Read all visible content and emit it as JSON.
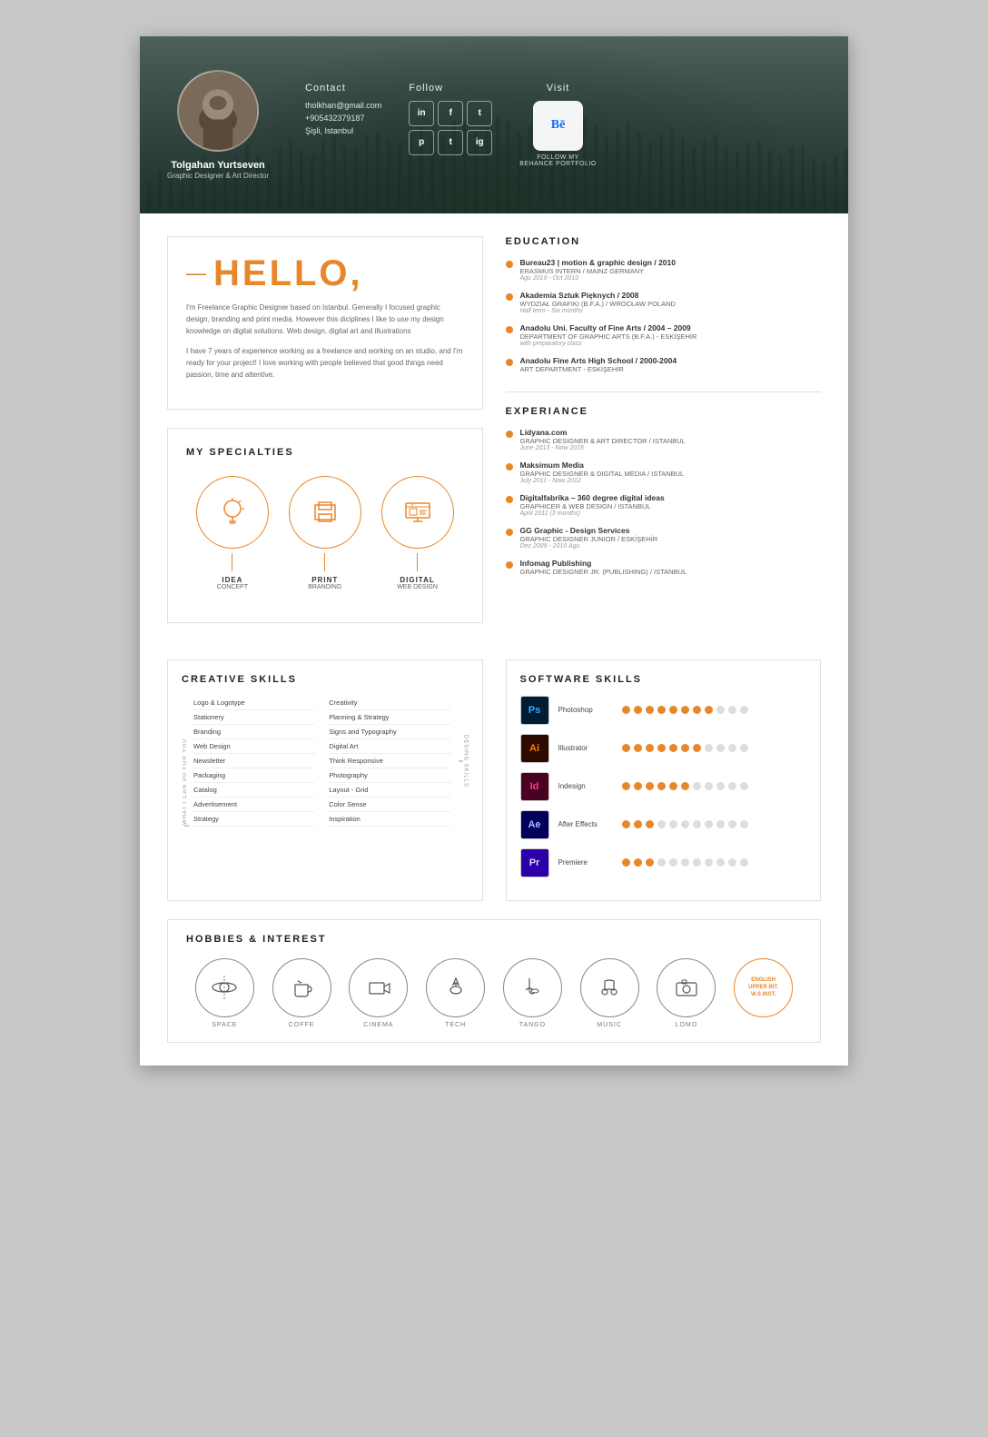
{
  "header": {
    "name": "Tolgahan Yurtseven",
    "title": "Graphic Designer & Art Director",
    "contact": {
      "label": "Contact",
      "email": "tholkhan@gmail.com",
      "phone": "+905432379187",
      "location": "Şişli, Istanbul"
    },
    "follow": {
      "label": "Follow",
      "icons": [
        "in",
        "f",
        "t",
        "p",
        "tu",
        "ig"
      ]
    },
    "visit": {
      "label": "Visit",
      "behance_text": "Bē",
      "behance_label": "FOLLOW MY\nBEHANCE PORTFOLIO"
    }
  },
  "hello": {
    "title": "HELLO,",
    "dash": "—",
    "para1": "I'm Freelance Graphic Designer based on Istanbul. Generally I focused graphic design, branding and print media. However this diciplines I like to use my design knowledge on digital solutions. Web design, digital art and illustrations",
    "para2": "I have 7 years of experience working as a freelance and working on an studio, and I'm ready for your project! I love working with people believed that good things need passion, time and attentive."
  },
  "specialties": {
    "title": "MY SPECIALTIES",
    "items": [
      {
        "icon": "💡",
        "label": "IDEA",
        "sub": "CONCEPT"
      },
      {
        "icon": "🖨",
        "label": "PRINT",
        "sub": "BRANDING"
      },
      {
        "icon": "🖥",
        "label": "DIGITAL",
        "sub": "WEB DESIGN"
      }
    ]
  },
  "education": {
    "title": "EDUCATION",
    "items": [
      {
        "title": "Bureau23 | motion & graphic design / 2010",
        "sub": "ERASMUS INTERN / MAINZ GERMANY",
        "date": "Agu 2010 - Oct 2010"
      },
      {
        "title": "Akademia Sztuk Pięknych / 2008",
        "sub": "WYDZIAŁ GRAFIKI (B.F.A.) / WROCŁAW POLAND",
        "date": "Half term - Six months"
      },
      {
        "title": "Anadolu Uni. Faculty of Fine Arts / 2004 – 2009",
        "sub": "DEPARTMENT OF GRAPHIC ARTS (B.F.A.) - ESKİŞEHİR",
        "date": "with preparatory class"
      },
      {
        "title": "Anadolu Fine Arts High School / 2000-2004",
        "sub": "ART DEPARTMENT - ESKİŞEHİR",
        "date": ""
      }
    ]
  },
  "experience": {
    "title": "EXPERIANCE",
    "items": [
      {
        "title": "Lidyana.com",
        "sub": "GRAPHIC DESIGNER & ART DIRECTOR / ISTANBUL",
        "date": "June 2013 - Now 2015"
      },
      {
        "title": "Maksimum Media",
        "sub": "GRAPHIC DESIGNER & DIGITAL MEDIA / ISTANBUL",
        "date": "July 2011 - Now 2012"
      },
      {
        "title": "Digitalfabrika – 360 degree digital ideas",
        "sub": "GRAPHICER & WEB DESIGN / ISTANBUL",
        "date": "April 2011 (3 months)"
      },
      {
        "title": "GG Graphic - Design Services",
        "sub": "GRAPHIC DESIGNER JUNIOR / ESKİŞEHİR",
        "date": "Dec 2009 - 2010 Agu"
      },
      {
        "title": "Infomag Publishing",
        "sub": "GRAPHIC DESIGNER JR. (PUBLISHING) / ISTANBUL",
        "date": ""
      }
    ]
  },
  "creative_skills": {
    "title": "CREATIVE SKILLS",
    "what_label": "WHAT I CAN DO FOR YOU",
    "design_label": "DESING SKILLS",
    "left_items": [
      "Logo & Logotype",
      "Stationery",
      "Branding",
      "Web Design",
      "Newsletter",
      "Packaging",
      "Catalog",
      "Advertisement",
      "Strategy"
    ],
    "right_items": [
      "Creativity",
      "Planning & Strategy",
      "Signs and Typography",
      "Digital Art",
      "Think Responsive",
      "Photography",
      "Layout - Grid",
      "Color Sense",
      "Inspiration"
    ]
  },
  "software_skills": {
    "title": "SOFTWARE SKILLS",
    "items": [
      {
        "name": "Photoshop",
        "icon": "Ps",
        "color_class": "sw-icon-ps",
        "filled": 8,
        "empty": 3
      },
      {
        "name": "Illustrator",
        "icon": "Ai",
        "color_class": "sw-icon-ai",
        "filled": 7,
        "empty": 4
      },
      {
        "name": "Indesign",
        "icon": "Id",
        "color_class": "sw-icon-id",
        "filled": 6,
        "empty": 5
      },
      {
        "name": "After Effects",
        "icon": "Ae",
        "color_class": "sw-icon-ae",
        "filled": 3,
        "empty": 8
      },
      {
        "name": "Premiere",
        "icon": "Pr",
        "color_class": "sw-icon-pr",
        "filled": 3,
        "empty": 8
      }
    ]
  },
  "hobbies": {
    "title": "HOBBIES & INTEREST",
    "items": [
      {
        "icon": "🔭",
        "label": "SPACE"
      },
      {
        "icon": "☕",
        "label": "COFFE"
      },
      {
        "icon": "🎬",
        "label": "CINEMA"
      },
      {
        "icon": "🚀",
        "label": "TECH"
      },
      {
        "icon": "👠",
        "label": "TANGO"
      },
      {
        "icon": "🎧",
        "label": "MUSIC"
      },
      {
        "icon": "📷",
        "label": "LOMO"
      }
    ],
    "english": {
      "line1": "ENGLISH",
      "line2": "UPPER INT.",
      "line3": "W.S.INST."
    }
  }
}
